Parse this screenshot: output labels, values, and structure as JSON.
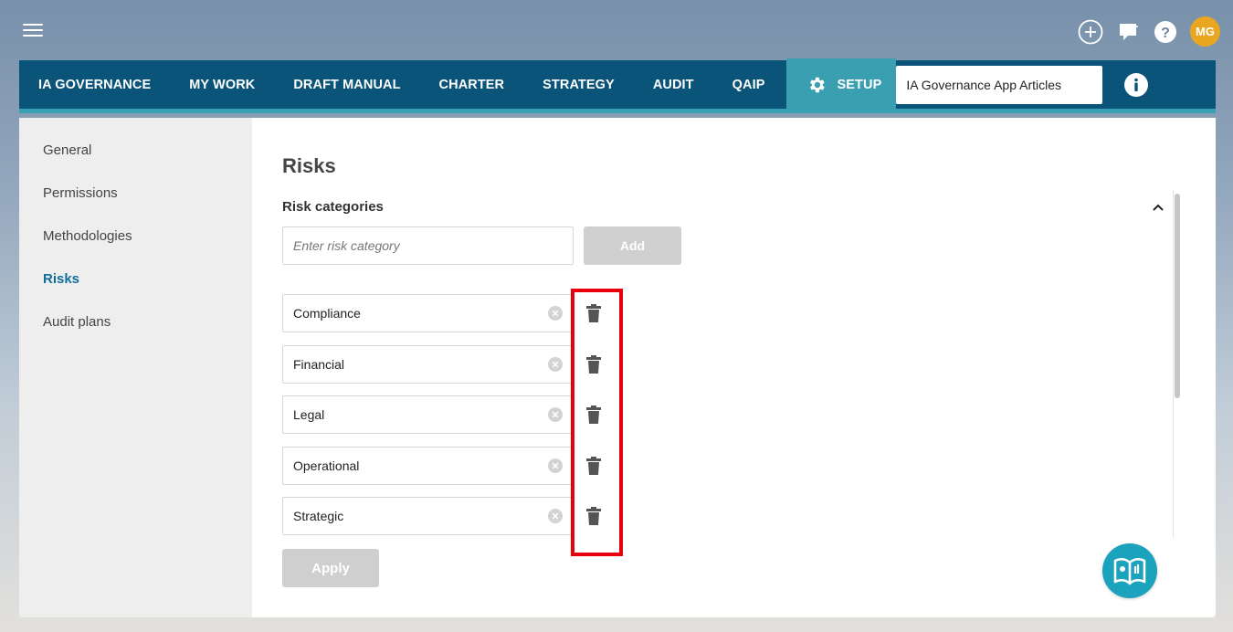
{
  "topbar": {
    "avatar_initials": "MG",
    "icons": [
      "menu-icon",
      "add-circle-icon",
      "chat-icon",
      "help-icon"
    ]
  },
  "nav": {
    "items": [
      {
        "label": "IA GOVERNANCE"
      },
      {
        "label": "MY WORK"
      },
      {
        "label": "DRAFT MANUAL"
      },
      {
        "label": "CHARTER"
      },
      {
        "label": "STRATEGY"
      },
      {
        "label": "AUDIT"
      },
      {
        "label": "QAIP"
      }
    ],
    "setup_label": "SETUP",
    "search_value": "IA Governance App Articles"
  },
  "sidebar": {
    "items": [
      {
        "label": "General"
      },
      {
        "label": "Permissions"
      },
      {
        "label": "Methodologies"
      },
      {
        "label": "Risks",
        "active": true
      },
      {
        "label": "Audit plans"
      }
    ]
  },
  "main": {
    "title": "Risks",
    "section_title": "Risk categories",
    "input_placeholder": "Enter risk category",
    "add_label": "Add",
    "apply_label": "Apply",
    "categories": [
      {
        "label": "Compliance"
      },
      {
        "label": "Financial"
      },
      {
        "label": "Legal"
      },
      {
        "label": "Operational"
      },
      {
        "label": "Strategic"
      }
    ]
  },
  "colors": {
    "nav_bg": "#0b5479",
    "setup_bg": "#3a9fb0",
    "active_link": "#0f6f9a",
    "highlight": "#e8000d",
    "avatar_bg": "#e8a621",
    "fab_bg": "#1ba2bc",
    "disabled_button": "#cfcfcf"
  }
}
